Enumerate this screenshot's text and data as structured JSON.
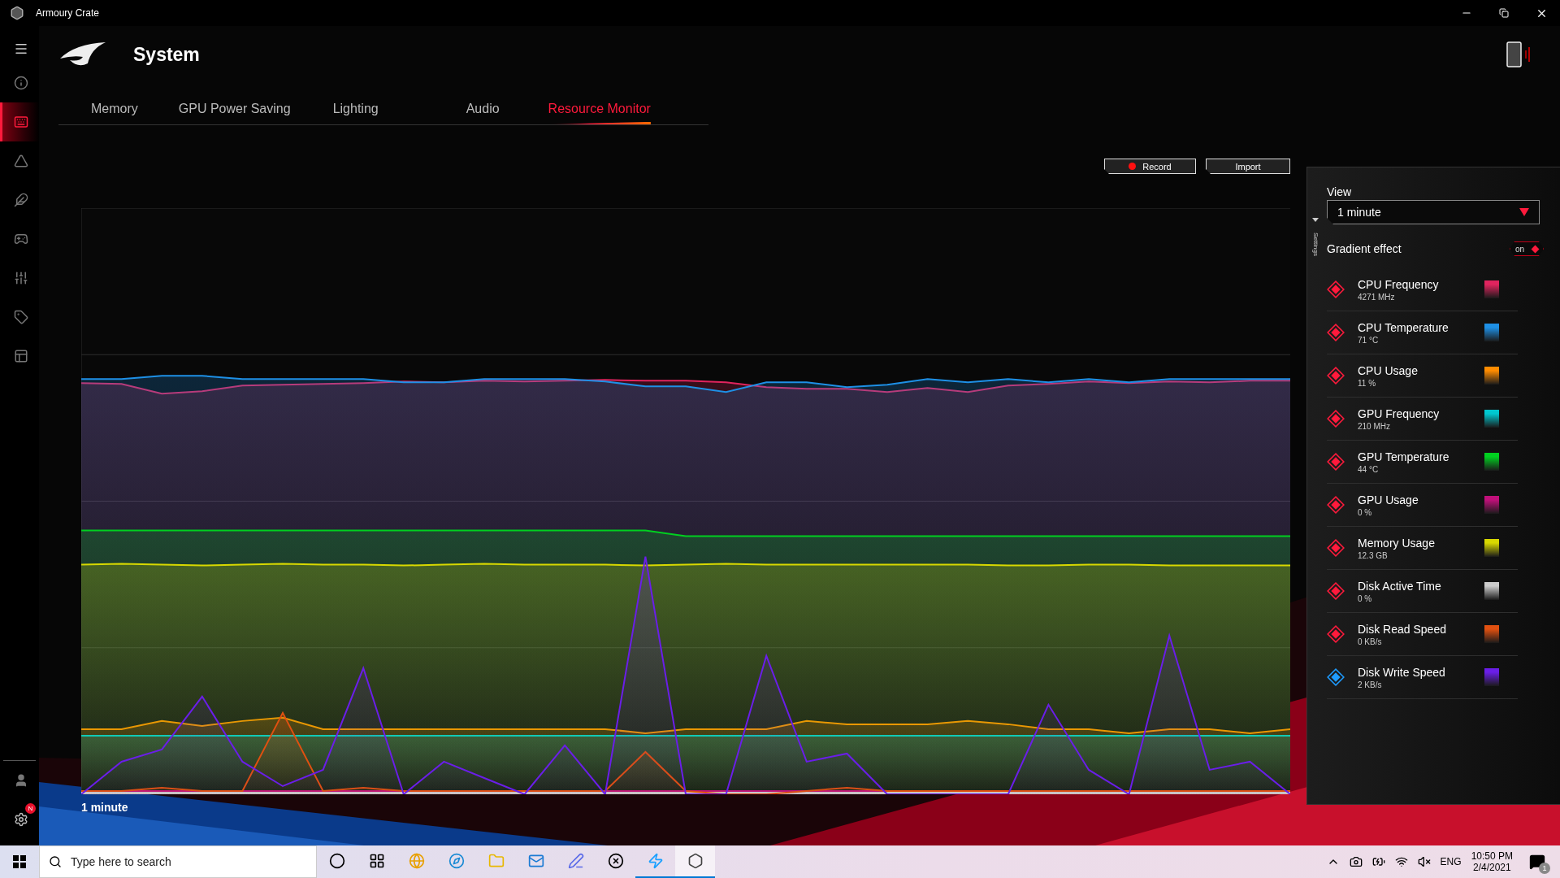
{
  "window": {
    "title": "Armoury Crate"
  },
  "sidebar": {
    "items": [
      {
        "selected": false
      },
      {
        "selected": true
      },
      {
        "selected": false
      },
      {
        "selected": false
      },
      {
        "selected": false
      },
      {
        "selected": false
      },
      {
        "selected": false
      },
      {
        "selected": false
      }
    ],
    "settings_badge": "N"
  },
  "header": {
    "title": "System"
  },
  "tabs": [
    {
      "label": "Memory",
      "selected": false
    },
    {
      "label": "GPU Power Saving",
      "selected": false
    },
    {
      "label": "Lighting",
      "selected": false
    },
    {
      "label": "Audio",
      "selected": false
    },
    {
      "label": "Resource Monitor",
      "selected": true
    }
  ],
  "actions": [
    {
      "label": "Record",
      "kind": "record"
    },
    {
      "label": "Import",
      "kind": "plain"
    }
  ],
  "chart": {
    "time_label": "1 minute"
  },
  "settings_panel": {
    "tab_label": "Settings",
    "view": {
      "label": "View",
      "value": "1 minute"
    },
    "gradient_effect": {
      "label": "Gradient effect",
      "state_text": "on",
      "on": true
    },
    "metrics": [
      {
        "name": "CPU Frequency",
        "value": "4271 MHz",
        "color": "#e0245e",
        "selected": false
      },
      {
        "name": "CPU Temperature",
        "value": "71 °C",
        "color": "#1e90e6",
        "selected": false
      },
      {
        "name": "CPU Usage",
        "value": "11 %",
        "color": "#ff8c00",
        "selected": false
      },
      {
        "name": "GPU Frequency",
        "value": "210 MHz",
        "color": "#00c8d0",
        "selected": false
      },
      {
        "name": "GPU Temperature",
        "value": "44 °C",
        "color": "#00d020",
        "selected": false
      },
      {
        "name": "GPU Usage",
        "value": "0 %",
        "color": "#c0107a",
        "selected": false
      },
      {
        "name": "Memory Usage",
        "value": "12.3 GB",
        "color": "#d8d800",
        "selected": false
      },
      {
        "name": "Disk Active Time",
        "value": "0 %",
        "color": "#cccccc",
        "selected": false
      },
      {
        "name": "Disk Read Speed",
        "value": "0 KB/s",
        "color": "#e05010",
        "selected": false
      },
      {
        "name": "Disk Write Speed",
        "value": "2 KB/s",
        "color": "#6a1ee8",
        "selected": true
      }
    ]
  },
  "taskbar": {
    "search": {
      "placeholder": "Type here to search"
    },
    "apps": [
      {
        "running": false,
        "selected": false
      },
      {
        "running": false,
        "selected": false
      },
      {
        "running": false,
        "selected": false
      },
      {
        "running": false,
        "selected": false
      },
      {
        "running": false,
        "selected": false
      },
      {
        "running": false,
        "selected": false
      },
      {
        "running": false,
        "selected": false
      },
      {
        "running": false,
        "selected": false
      },
      {
        "running": true,
        "selected": false
      },
      {
        "running": true,
        "selected": true
      }
    ],
    "language": "ENG",
    "time": "10:50 PM",
    "date": "2/4/2021",
    "notification_count": "1"
  }
}
